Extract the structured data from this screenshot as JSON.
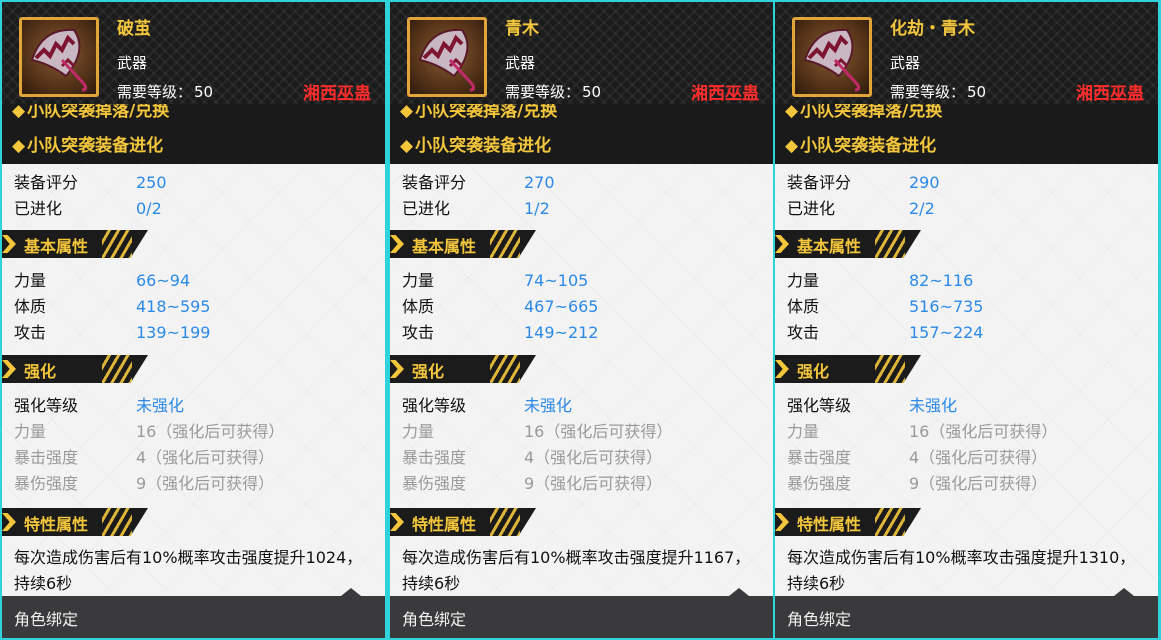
{
  "labels": {
    "type": "武器",
    "req_level_label": "需要等级：",
    "region": "湘西巫蛊",
    "source1": "小队突袭掉落/兑换",
    "source2": "小队突袭装备进化",
    "score_label": "装备评分",
    "evolved_label": "已进化",
    "basic_attr": "基本属性",
    "strength": "力量",
    "constitution": "体质",
    "attack": "攻击",
    "enhance": "强化",
    "enhance_level": "强化等级",
    "crit_strength": "暴击强度",
    "crit_damage": "暴伤强度",
    "trait_attr": "特性属性",
    "bind": "角色绑定"
  },
  "icon": "umbrella-weapon-icon",
  "colors": {
    "gold": "#f3c63c",
    "blue": "#2c8ae6",
    "red": "#ff2c2c",
    "border": "#2fd3dc"
  },
  "panels": [
    {
      "name": "破茧",
      "req_level": "50",
      "score": "250",
      "evolved": "0/2",
      "strength": "66~94",
      "constitution": "418~595",
      "attack": "139~199",
      "enhance_level": "未强化",
      "enh_strength": "16（强化后可获得）",
      "enh_crit": "4（强化后可获得）",
      "enh_critdmg": "9（强化后可获得）",
      "trait": "每次造成伤害后有10%概率攻击强度提升1024，持续6秒"
    },
    {
      "name": "青木",
      "req_level": "50",
      "score": "270",
      "evolved": "1/2",
      "strength": "74~105",
      "constitution": "467~665",
      "attack": "149~212",
      "enhance_level": "未强化",
      "enh_strength": "16（强化后可获得）",
      "enh_crit": "4（强化后可获得）",
      "enh_critdmg": "9（强化后可获得）",
      "trait": "每次造成伤害后有10%概率攻击强度提升1167，持续6秒"
    },
    {
      "name": "化劫・青木",
      "req_level": "50",
      "score": "290",
      "evolved": "2/2",
      "strength": "82~116",
      "constitution": "516~735",
      "attack": "157~224",
      "enhance_level": "未强化",
      "enh_strength": "16（强化后可获得）",
      "enh_crit": "4（强化后可获得）",
      "enh_critdmg": "9（强化后可获得）",
      "trait": "每次造成伤害后有10%概率攻击强度提升1310，持续6秒"
    }
  ]
}
